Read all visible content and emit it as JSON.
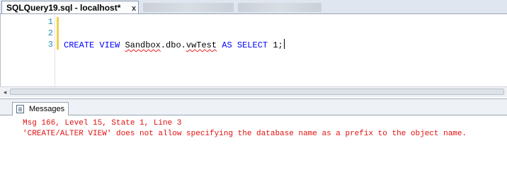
{
  "document_tab": {
    "title": "SQLQuery19.sql - localhost*",
    "close_glyph": "x"
  },
  "editor": {
    "line_numbers": [
      "1",
      "2",
      "3"
    ],
    "code": {
      "kw_create": "CREATE",
      "kw_view": "VIEW",
      "object_db": "Sandbox",
      "object_rest": ".dbo.",
      "object_name": "vwTest",
      "kw_as": "AS",
      "kw_select": "SELECT",
      "value": "1;"
    }
  },
  "results": {
    "tab_label": "Messages",
    "messages": [
      "Msg 166, Level 15, State 1, Line 3",
      "'CREATE/ALTER VIEW' does not allow specifying the database name as a prefix to the object name."
    ]
  },
  "colors": {
    "keyword": "#0000ff",
    "line_number": "#2b91af",
    "error_text": "#e01010",
    "squiggle": "#e02020",
    "change_bar": "#f2cf4a"
  }
}
